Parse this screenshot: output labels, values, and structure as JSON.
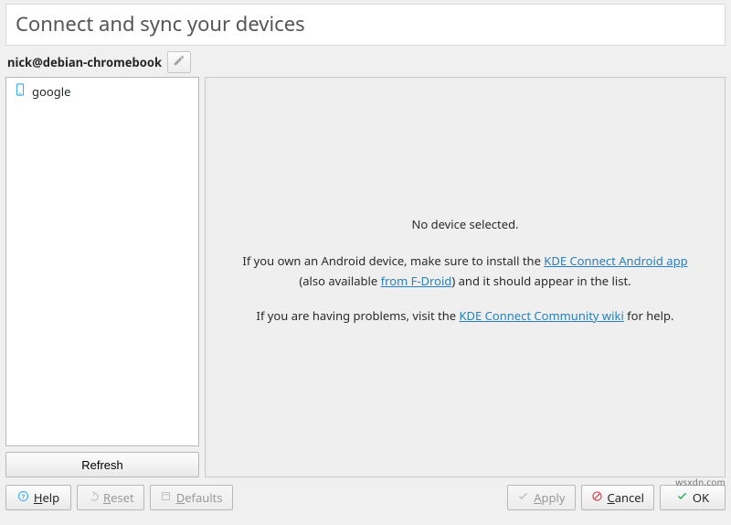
{
  "header": {
    "title": "Connect and sync your devices"
  },
  "host": {
    "label": "nick@debian-chromebook"
  },
  "sidebar": {
    "devices": [
      {
        "name": "google"
      }
    ],
    "refresh_label": "Refresh"
  },
  "content": {
    "heading": "No device selected.",
    "para1_prefix": "If you own an Android device, make sure to install the ",
    "link1": "KDE Connect Android app",
    "para1_mid": " (also available ",
    "link2": "from F-Droid",
    "para1_suffix": ") and it should appear in the list.",
    "para2_prefix": "If you are having problems, visit the ",
    "link3": "KDE Connect Community wiki",
    "para2_suffix": " for help."
  },
  "buttons": {
    "help": "elp",
    "reset": "eset",
    "defaults": "efaults",
    "apply": "pply",
    "cancel": "ancel",
    "ok": "OK"
  },
  "watermark": "wsxdn.com"
}
